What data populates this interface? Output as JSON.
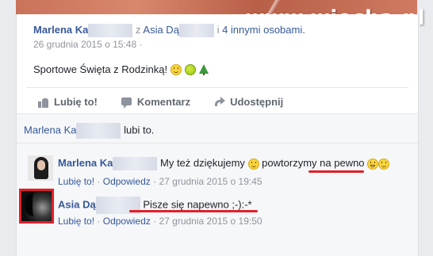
{
  "watermark": "www.wiocha.pl",
  "post": {
    "author": "Marlena Ka",
    "with_word": "z",
    "tagged_person": "Asia Dą",
    "and_word": "i",
    "others_link": "4 innymi osobami.",
    "timestamp": "26 grudnia 2015 o 15:48",
    "separator": "·",
    "text": "Sportowe Święta z Rodzinką!"
  },
  "actions": {
    "like": "Lubię to!",
    "comment": "Komentarz",
    "share": "Udostępnij"
  },
  "likes": {
    "name": "Marlena Ka",
    "suffix": "lubi to."
  },
  "comments": [
    {
      "author": "Marlena Ka",
      "text_before": "My też dziękujemy",
      "text_middle": "powtorzymy",
      "text_highlight": "na pewno",
      "like": "Lubię to!",
      "sep": "·",
      "reply": "Odpowiedz",
      "time": "27 grudnia 2015 o 19:45"
    },
    {
      "author": "Asia Dą",
      "text_highlight": "Pisze się napewno ;-):-*",
      "like": "Lubię to!",
      "sep": "·",
      "reply": "Odpowiedz",
      "time": "27 grudnia 2015 o 19:50"
    }
  ],
  "colors": {
    "link": "#365899",
    "highlight_red": "#e0202a",
    "meta_gray": "#90949c"
  }
}
